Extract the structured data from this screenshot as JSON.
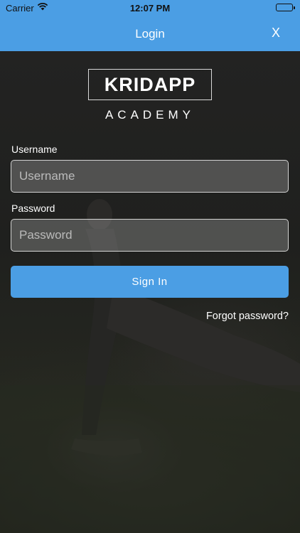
{
  "status_bar": {
    "carrier": "Carrier",
    "time": "12:07 PM",
    "wifi_icon": "wifi-icon",
    "battery_icon": "battery-icon"
  },
  "nav": {
    "title": "Login",
    "close_label": "X"
  },
  "logo": {
    "brand": "KRIDAPP",
    "subtitle": "ACADEMY"
  },
  "form": {
    "username_label": "Username",
    "username_placeholder": "Username",
    "username_value": "",
    "password_label": "Password",
    "password_placeholder": "Password",
    "password_value": "",
    "signin_label": "Sign In",
    "forgot_label": "Forgot password?"
  },
  "colors": {
    "accent": "#4b9ee4",
    "background": "#1b1c1a"
  }
}
